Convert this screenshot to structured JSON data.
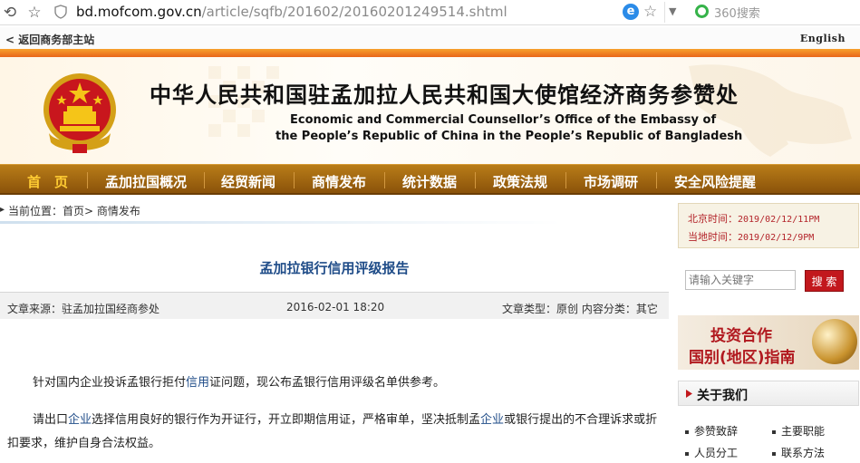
{
  "browser": {
    "url_domain": "bd.mofcom.gov.cn",
    "url_path": "/article/sqfb/201602/20160201249514.shtml",
    "ie_icon": "e",
    "search_placeholder": "360搜索"
  },
  "toplinks": {
    "back_label": "返回商务部主站",
    "english_label": "English"
  },
  "banner": {
    "title_cn": "中华人民共和国驻孟加拉人民共和国大使馆经济商务参赞处",
    "title_en_line1": "Economic and Commercial Counsellor’s Office of the Embassy of",
    "title_en_line2": "the People’s Republic of China in the People’s Republic of Bangladesh"
  },
  "nav": {
    "items": [
      "首　页",
      "孟加拉国概况",
      "经贸新闻",
      "商情发布",
      "统计数据",
      "政策法规",
      "市场调研",
      "安全风险提醒"
    ]
  },
  "breadcrumb": {
    "text": "当前位置：首页> 商情发布"
  },
  "article": {
    "title": "孟加拉银行信用评级报告",
    "source": "文章来源：驻孟加拉国经商参处",
    "datetime": "2016-02-01 18:20",
    "category": "文章类型：原创 内容分类：其它",
    "para1_before": "针对国内企业投诉孟银行拒付",
    "para1_link": "信用",
    "para1_after": "证问题，现公布孟银行信用评级名单供参考。",
    "para2_before": "请出口",
    "para2_link1": "企业",
    "para2_mid": "选择信用良好的银行作为开证行，开立即期信用证，严格审单，坚决抵制孟",
    "para2_link2": "企业",
    "para2_after": "或银行提出的不合理诉求或折扣要求，维护自身合法权益。"
  },
  "sidebar": {
    "beijing_label": "北京时间：",
    "beijing_time": "2019/02/12/11PM",
    "local_label": "当地时间：",
    "local_time": "2019/02/12/9PM",
    "keyword_placeholder": "请输入关键字",
    "search_button": "搜 索",
    "promo_line1": "投资合作",
    "promo_line2": "国别(地区)指南",
    "about_title": "关于我们",
    "about_links": [
      "参赞致辞",
      "主要职能",
      "人员分工",
      "联系方法"
    ]
  },
  "colors": {
    "nav_bg": "#a76a12",
    "nav_home": "#ffcc33",
    "title_blue": "#1f4c88",
    "accent_red": "#c2181d"
  }
}
